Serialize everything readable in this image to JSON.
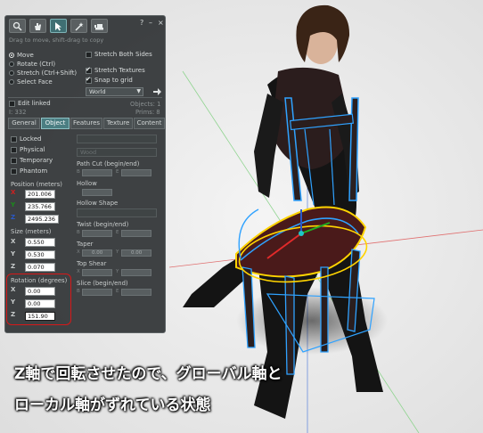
{
  "toolbar": {
    "tools": [
      "focus-tool",
      "move-tool",
      "edit-tool",
      "create-tool",
      "land-tool"
    ],
    "active_tool": "edit-tool",
    "help_label": "?",
    "minimize_label": "–",
    "close_label": "×",
    "hint": "Drag to move, shift-drag to copy"
  },
  "modes": {
    "move": "Move",
    "rotate": "Rotate (Ctrl)",
    "stretch": "Stretch (Ctrl+Shift)",
    "select_face": "Select Face",
    "selected": "move"
  },
  "options": {
    "stretch_both_sides": "Stretch Both Sides",
    "stretch_textures": "Stretch Textures",
    "snap_to_grid": "Snap to grid",
    "grid_mode": "World"
  },
  "selection": {
    "edit_linked": "Edit linked",
    "objects": "Objects: 1",
    "id": "I: 332",
    "prims": "Prims: 8"
  },
  "tabs": [
    "General",
    "Object",
    "Features",
    "Texture",
    "Content"
  ],
  "active_tab": "Object",
  "flags": {
    "locked": "Locked",
    "physical": "Physical",
    "temporary": "Temporary",
    "phantom": "Phantom",
    "material": "Wood"
  },
  "position": {
    "label": "Position (meters)",
    "x": "201.006",
    "y": "235.766",
    "z": "2495.236"
  },
  "size": {
    "label": "Size (meters)",
    "x": "0.550",
    "y": "0.530",
    "z": "0.070"
  },
  "rotation": {
    "label": "Rotation (degrees)",
    "x": "0.00",
    "y": "0.00",
    "z": "151.90"
  },
  "shape": {
    "path_cut": "Path Cut (begin/end)",
    "hollow": "Hollow",
    "hollow_shape": "Hollow Shape",
    "twist": "Twist (begin/end)",
    "taper": "Taper",
    "top_shear": "Top Shear",
    "slice": "Slice (begin/end)",
    "b": "B",
    "e": "E",
    "x": "X",
    "y": "Y",
    "taper_x": "0.00",
    "taper_y": "0.00"
  },
  "axis_labels": {
    "x": "X",
    "y": "Y",
    "z": "Z"
  },
  "caption": {
    "line1": "Z軸で回転させたので、グローバル軸と",
    "line2": "ローカル軸がずれている状態"
  },
  "colors": {
    "axis_x": "#d22020",
    "axis_y": "#1a8d1a",
    "axis_z": "#2a58c8",
    "highlight": "#d81818",
    "gizmo": "#1e9cff"
  }
}
